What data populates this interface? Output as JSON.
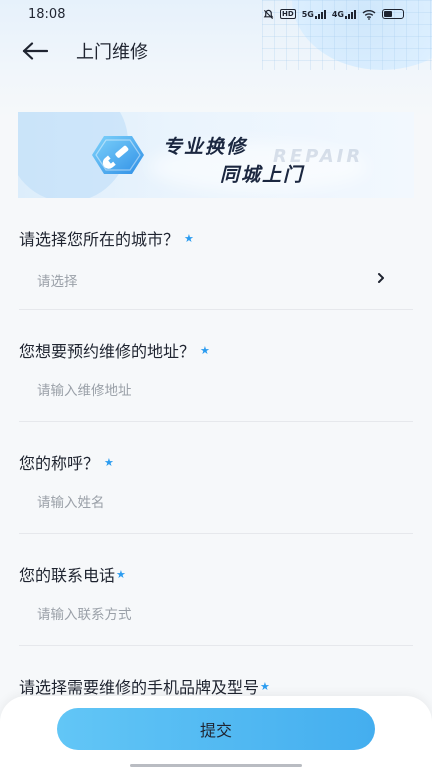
{
  "status_bar": {
    "time": "18:08",
    "hd_label": "HD",
    "net1": "5G",
    "net2": "4G"
  },
  "nav": {
    "title": "上门维修"
  },
  "banner": {
    "line1": "专业换修",
    "line2": "同城上门",
    "watermark": "REPAIR"
  },
  "form": {
    "city": {
      "label": "请选择您所在的城市？",
      "value": "请选择"
    },
    "address": {
      "label": "您想要预约维修的地址？",
      "placeholder": "请输入维修地址"
    },
    "name": {
      "label": "您的称呼？",
      "placeholder": "请输入姓名"
    },
    "phone": {
      "label": "您的联系电话",
      "placeholder": "请输入联系方式"
    },
    "brand": {
      "label": "请选择需要维修的手机品牌及型号"
    },
    "required_mark": "★"
  },
  "submit": {
    "label": "提交"
  },
  "colors": {
    "accent": "#44aeef",
    "required_star": "#2b9cf0"
  },
  "icons": [
    "back-arrow-icon",
    "wrench-icon",
    "chevron-right-icon",
    "wifi-icon",
    "battery-icon",
    "signal-icon",
    "mute-icon"
  ]
}
